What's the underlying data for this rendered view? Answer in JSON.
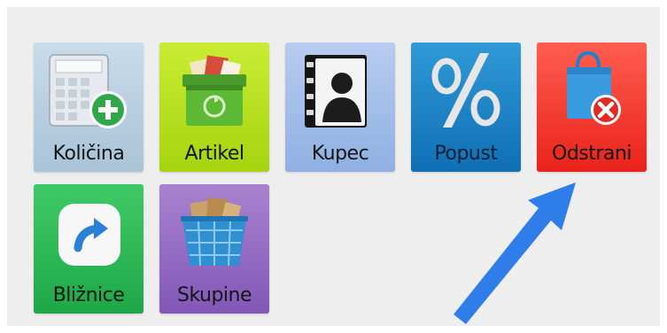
{
  "toolbar": {
    "tiles": [
      {
        "label": "Količina",
        "icon": "quantity-calculator-icon"
      },
      {
        "label": "Artikel",
        "icon": "article-box-icon"
      },
      {
        "label": "Kupec",
        "icon": "customer-contact-icon"
      },
      {
        "label": "Popust",
        "icon": "discount-percent-icon"
      },
      {
        "label": "Odstrani",
        "icon": "remove-bag-icon"
      },
      {
        "label": "Bližnice",
        "icon": "shortcut-arrow-icon"
      },
      {
        "label": "Skupine",
        "icon": "groups-basket-icon"
      }
    ]
  },
  "colors": {
    "kolicina": "#b8cfe1",
    "artikel": "#b8e020",
    "kupec": "#a3bee9",
    "popust": "#1f84c6",
    "odstrani": "#f43f35",
    "bliznice": "#2eb856",
    "skupine": "#956dc4",
    "annotation_arrow": "#2f7de8"
  }
}
